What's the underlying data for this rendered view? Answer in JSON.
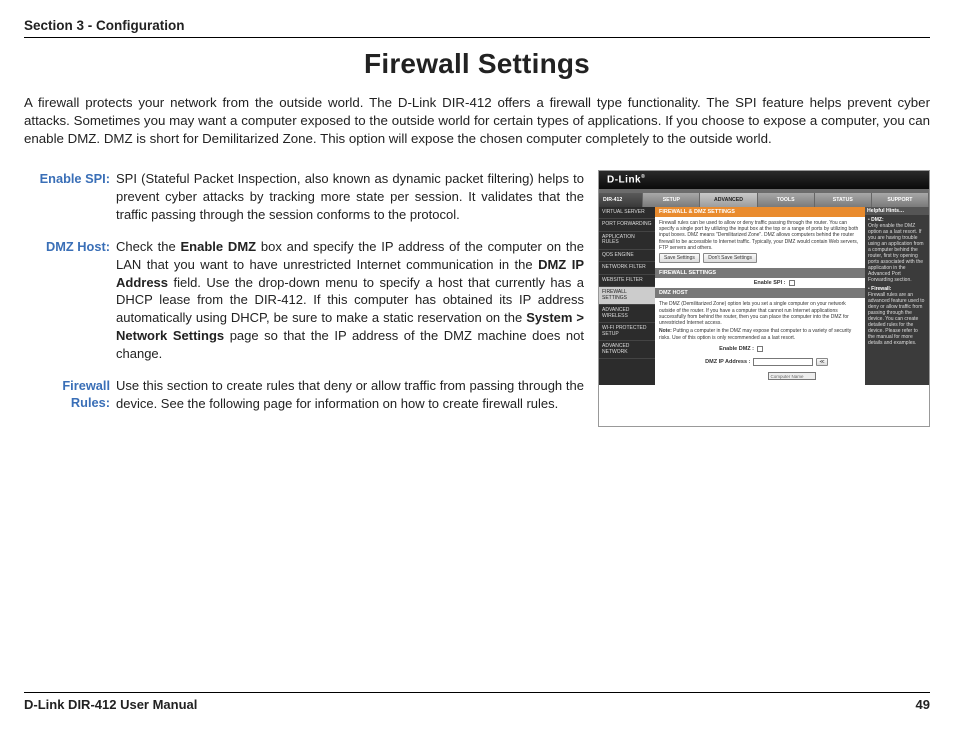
{
  "header": {
    "section": "Section 3 - Configuration"
  },
  "title": "Firewall Settings",
  "intro": "A firewall protects your network from the outside world. The D-Link DIR-412 offers a firewall type functionality. The SPI feature helps prevent cyber attacks. Sometimes you may want a computer exposed to the outside world for certain types of applications. If you choose to expose a computer, you can enable DMZ. DMZ is short for Demilitarized Zone. This option will expose the chosen computer completely to the outside world.",
  "defs": {
    "spi": {
      "label": "Enable SPI:",
      "text": "SPI (Stateful Packet Inspection, also known as dynamic packet filtering) helps to prevent cyber attacks by tracking more state per session. It validates that the traffic passing through the session conforms to the protocol."
    },
    "dmz": {
      "label": "DMZ Host:",
      "t1": "Check the ",
      "b1": "Enable DMZ",
      "t2": " box and specify the IP address of the computer on the LAN that you want to have unrestricted Internet communication in the ",
      "b2": "DMZ IP Address",
      "t3": " field. Use the drop-down menu to specify a host that currently has a DHCP lease from the DIR-412. If this computer has obtained its IP address automatically using DHCP, be sure to make a static reservation on the ",
      "b3": "System > Network Settings",
      "t4": " page so that the IP address of the DMZ machine does not change."
    },
    "rules": {
      "label": "Firewall Rules:",
      "text": "Use this section to create rules that deny or allow traffic from passing through the device. See the following page for information on how to create firewall rules."
    }
  },
  "router": {
    "logo": "D-Link",
    "model": "DIR-412",
    "tabs": [
      "SETUP",
      "ADVANCED",
      "TOOLS",
      "STATUS",
      "SUPPORT"
    ],
    "side": [
      "VIRTUAL SERVER",
      "PORT FORWARDING",
      "APPLICATION RULES",
      "QOS ENGINE",
      "NETWORK FILTER",
      "WEBSITE FILTER",
      "FIREWALL SETTINGS",
      "ADVANCED WIRELESS",
      "WI-FI PROTECTED SETUP",
      "ADVANCED NETWORK"
    ],
    "panel1": {
      "title": "FIREWALL & DMZ SETTINGS",
      "text": "Firewall rules can be used to allow or deny traffic passing through the router. You can specify a single port by utilizing the input box at the top or a range of ports by utilizing both input boxes. DMZ means \"Demilitarized Zone\". DMZ allows computers behind the router firewall to be accessible to Internet traffic. Typically, your DMZ would contain Web servers, FTP servers and others.",
      "btn_save": "Save Settings",
      "btn_cancel": "Don't Save Settings"
    },
    "panel2": {
      "title": "FIREWALL SETTINGS",
      "field": "Enable SPI :"
    },
    "panel3": {
      "title": "DMZ HOST",
      "text": "The DMZ (Demilitarized Zone) option lets you set a single computer on your network outside of the router. If you have a computer that cannot run Internet applications successfully from behind the router, then you can place the computer into the DMZ for unrestricted Internet access.",
      "note_label": "Note:",
      "note": " Putting a computer in the DMZ may expose that computer to a variety of security risks. Use of this option is only recommended as a last resort.",
      "f1": "Enable DMZ :",
      "f2": "DMZ IP Address :",
      "select": "Computer Name"
    },
    "hints": {
      "title": "Helpful Hints…",
      "d_label": "DMZ:",
      "d_text": "Only enable the DMZ option as a last resort. If you are having trouble using an application from a computer behind the router, first try opening ports associated with the application in the Advanced Port Forwarding section.",
      "f_label": "Firewall:",
      "f_text": "Firewall rules are an advanced feature used to deny or allow traffic from passing through the device. You can create detailed rules for the device. Please refer to the manual for more details and examples."
    }
  },
  "footer": {
    "left": "D-Link DIR-412 User Manual",
    "page": "49"
  }
}
